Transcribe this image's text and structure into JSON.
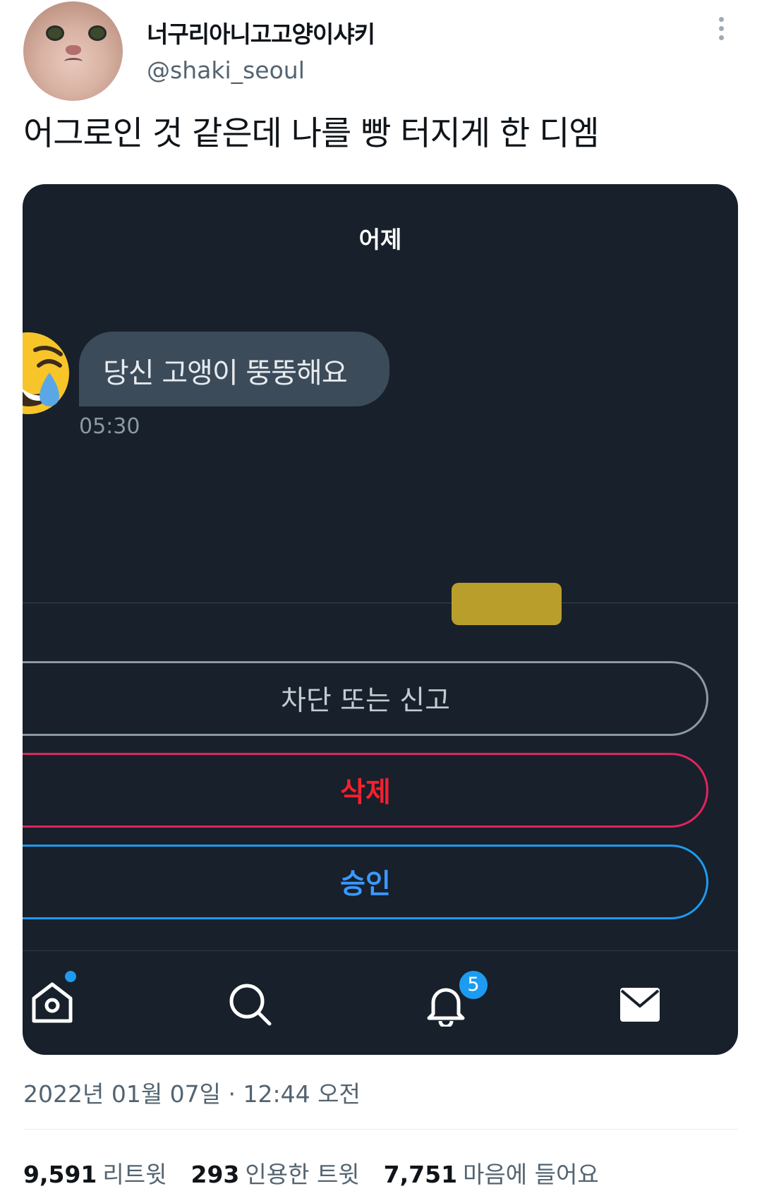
{
  "tweet": {
    "display_name": "너구리아니고고양이샤키",
    "handle": "@shaki_seoul",
    "text": "어그로인 것 같은데 나를 빵 터지게 한 디엠",
    "timestamp": "2022년 01월 07일 · 12:44 오전",
    "stats": [
      {
        "num": "9,591",
        "label": "리트윗"
      },
      {
        "num": "293",
        "label": "인용한 트윗"
      },
      {
        "num": "7,751",
        "label": "마음에 들어요"
      }
    ]
  },
  "dm": {
    "day_label": "어제",
    "message": "당신 고앵이 뚱뚱해요",
    "time": "05:30",
    "sender_emoji": "laughing-with-tears-emoji",
    "buttons": {
      "block_report": "차단 또는 신고",
      "delete": "삭제",
      "accept": "승인"
    },
    "tabbar": {
      "notification_badge": "5",
      "icons": [
        "home-icon",
        "search-icon",
        "bell-icon",
        "mail-icon"
      ]
    }
  },
  "colors": {
    "dm_background": "#17202b",
    "bubble": "#3c4b5a",
    "delete_red": "#f4212e",
    "accept_blue": "#1d9bf0",
    "secondary_text": "#536471"
  }
}
